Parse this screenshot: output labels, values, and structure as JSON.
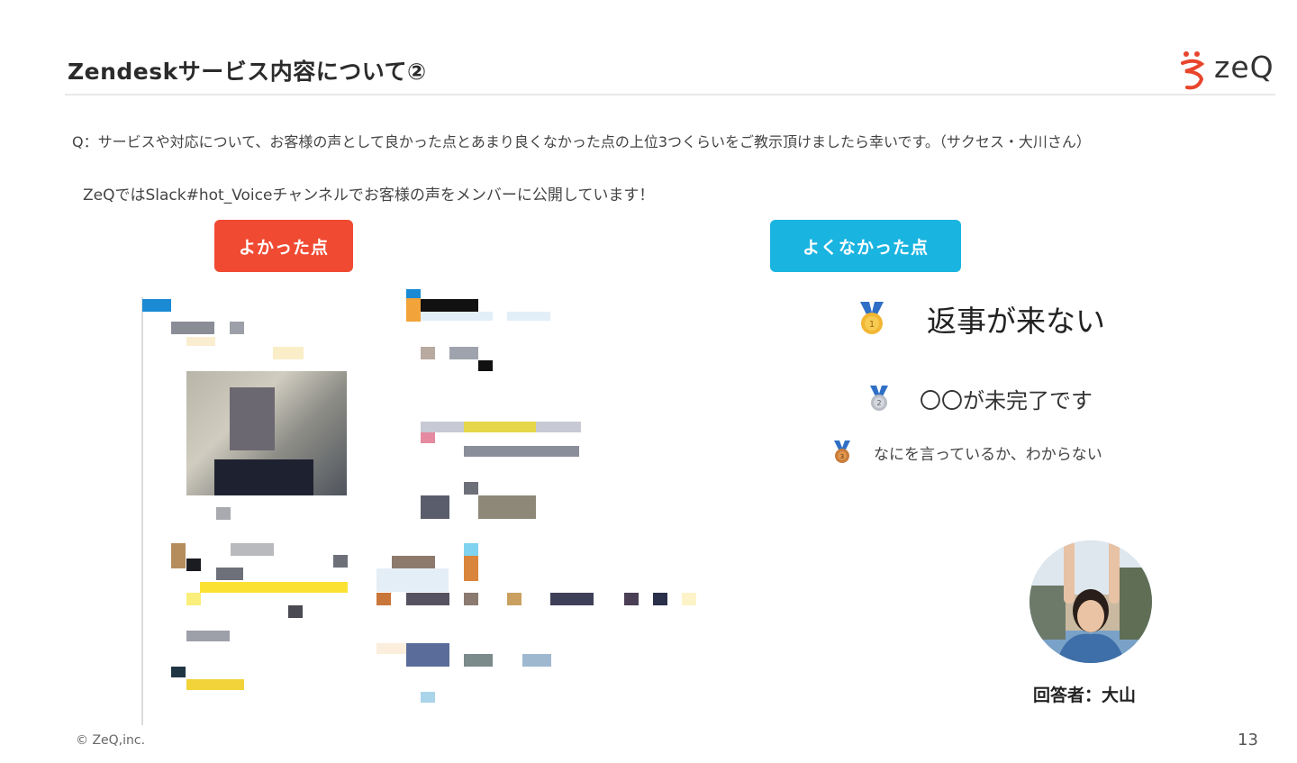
{
  "slide": {
    "title": "Zendeskサービス内容について②",
    "logo_text": "zeQ",
    "logo_icon": "zeq-mark-icon",
    "question": "Q：サービスや対応について、お客様の声として良かった点とあまり良くなかった点の上位3つくらいをご教示頂けましたら幸いです。（サクセス・大川さん）",
    "intro": "ZeQではSlack#hot_Voiceチャンネルでお客様の声をメンバーに公開しています！",
    "good_label": "よかった点",
    "bad_label": "よくなかった点",
    "bad_points": [
      {
        "rank": "1",
        "text": "返事が来ない",
        "icon": "gold-medal-icon"
      },
      {
        "rank": "2",
        "text": "〇〇が未完了です",
        "icon": "silver-medal-icon"
      },
      {
        "rank": "3",
        "text": "なにを言っているか、わからない",
        "icon": "bronze-medal-icon"
      }
    ],
    "respondent": "回答者：大山",
    "copyright": "© ZeQ,inc.",
    "page_number": "13"
  },
  "colors": {
    "good": "#f04a33",
    "bad": "#1ab4e0",
    "logo_accent": "#e8452c"
  }
}
